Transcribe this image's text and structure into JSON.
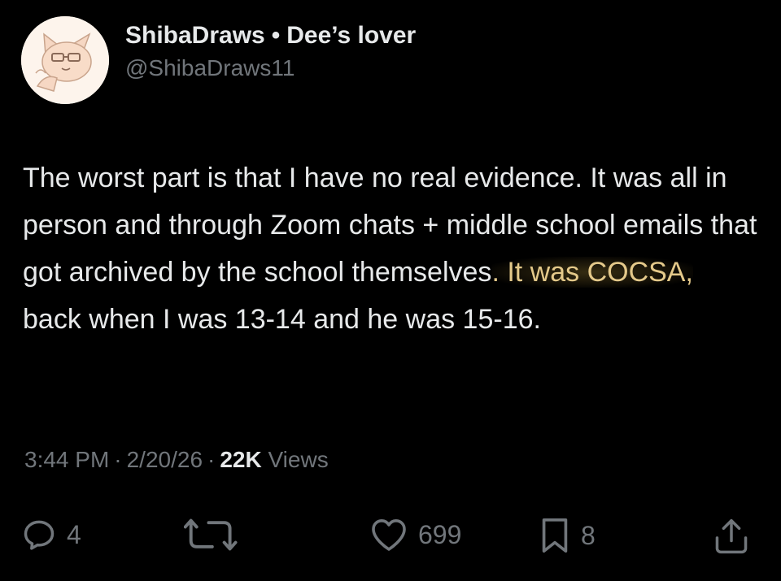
{
  "author": {
    "display_name": "ShibaDraws",
    "separator": "•",
    "name_suffix": "Dee’s lover",
    "handle": "@ShibaDraws11",
    "avatar_icon": "avatar-image"
  },
  "tweet": {
    "text_before": "The worst part is that I have no real evidence. It was all in person and through Zoom chats + middle school emails that got archived by the school themselves",
    "text_highlight": ". It was COCSA,",
    "text_after": " back when I was 13-14 and he was 15-16.",
    "highlight_color": "#e4c98a"
  },
  "meta": {
    "time": "3:44 PM",
    "dot1": "·",
    "date": "2/20/26",
    "dot2": "·",
    "views_count": "22K",
    "views_label": "Views"
  },
  "actions": {
    "reply": {
      "icon": "reply-icon",
      "count": "4"
    },
    "retweet": {
      "icon": "retweet-icon",
      "count": ""
    },
    "like": {
      "icon": "heart-icon",
      "count": "699"
    },
    "bookmark": {
      "icon": "bookmark-icon",
      "count": "8"
    },
    "share": {
      "icon": "share-icon"
    }
  },
  "colors": {
    "background": "#000000",
    "primary_text": "#e7e9ea",
    "secondary_text": "#71767b"
  }
}
